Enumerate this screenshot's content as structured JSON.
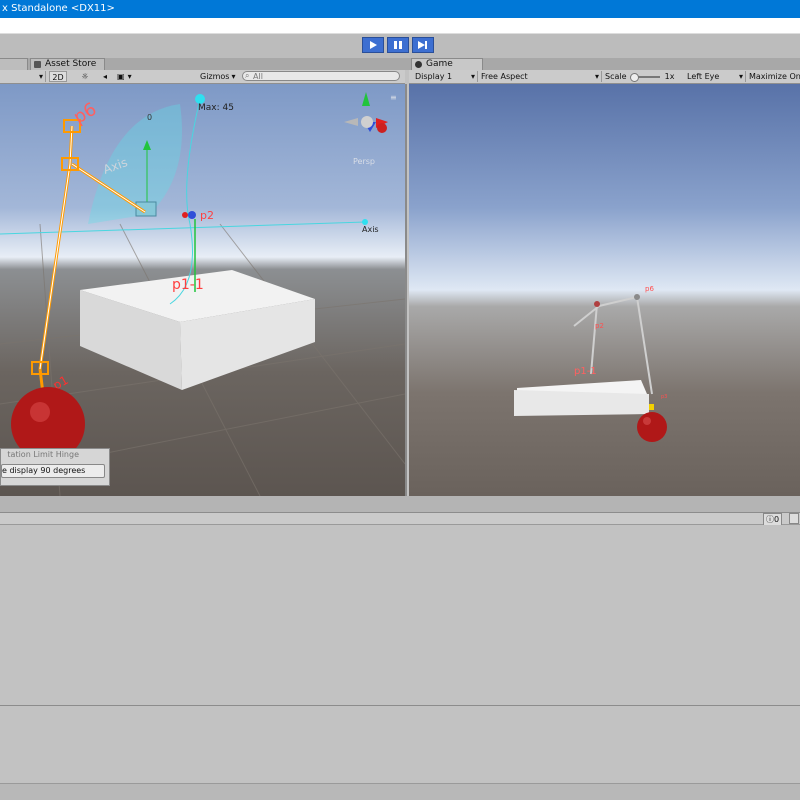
{
  "window": {
    "title": "x Standalone <DX11>"
  },
  "toolbar": {
    "play_icon": "play-icon",
    "pause_icon": "pause-icon",
    "step_icon": "step-icon",
    "accent": "#3d6fd1"
  },
  "tabs": {
    "asset_store": "Asset Store",
    "game": "Game"
  },
  "scene_toolbar": {
    "mode_2d": "2D",
    "gizmos": "Gizmos",
    "search_value": "All"
  },
  "game_toolbar": {
    "display": "Display 1",
    "aspect": "Free Aspect",
    "scale_label": "Scale",
    "scale_value": "1x",
    "eye": "Left Eye",
    "maximize": "Maximize On"
  },
  "scene_labels": {
    "max": "Max: 45",
    "min": "0",
    "axis": "Axis",
    "node": "p1-1",
    "persp": "Persp",
    "p6": "p6",
    "axis_blur": "Axis",
    "p2": "p2",
    "p1": "p1"
  },
  "game_labels": {
    "p6": "p6",
    "p1": "p1-1",
    "p2": "p2",
    "p3": "p3"
  },
  "hinge_panel": {
    "title": "tation Limit Hinge",
    "button": "e display 90 degrees"
  },
  "bottom_panel": {
    "count": "0"
  },
  "colors": {
    "titlebar": "#0078d7",
    "sphere": "#b01818",
    "gizmo": "#ff9a00",
    "arc": "#49d6e0"
  }
}
